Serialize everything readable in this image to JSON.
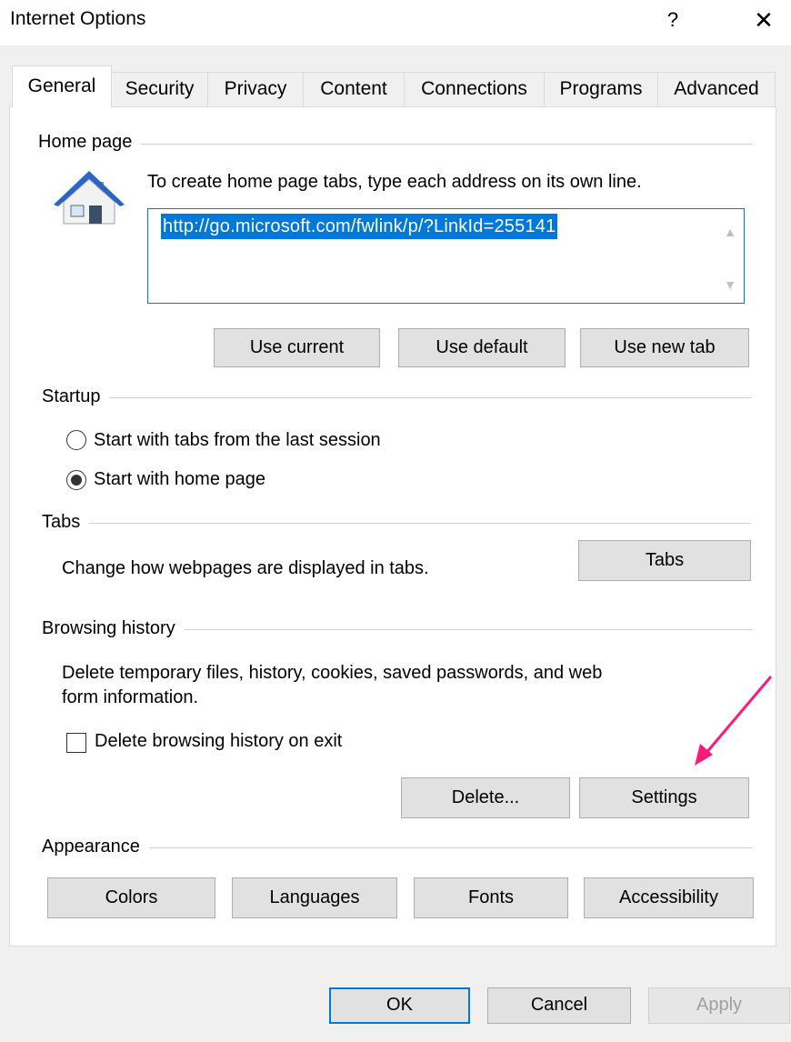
{
  "window": {
    "title": "Internet Options",
    "help_label": "?",
    "close_label": "✕"
  },
  "tabs": [
    {
      "label": "General",
      "active": true
    },
    {
      "label": "Security"
    },
    {
      "label": "Privacy"
    },
    {
      "label": "Content"
    },
    {
      "label": "Connections"
    },
    {
      "label": "Programs"
    },
    {
      "label": "Advanced"
    }
  ],
  "home_page": {
    "group_label": "Home page",
    "instructions": "To create home page tabs, type each address on its own line.",
    "address_value": "http://go.microsoft.com/fwlink/p/?LinkId=255141",
    "use_current_label": "Use current",
    "use_default_label": "Use default",
    "use_new_tab_label": "Use new tab"
  },
  "startup": {
    "group_label": "Startup",
    "option_last_session": "Start with tabs from the last session",
    "option_home_page": "Start with home page",
    "selected": "home_page"
  },
  "tabs_section": {
    "group_label": "Tabs",
    "description": "Change how webpages are displayed in tabs.",
    "button_label": "Tabs"
  },
  "browsing_history": {
    "group_label": "Browsing history",
    "description_line1": "Delete temporary files, history, cookies, saved passwords, and web",
    "description_line2": "form information.",
    "delete_on_exit_label": "Delete browsing history on exit",
    "delete_on_exit_checked": false,
    "delete_label": "Delete...",
    "settings_label": "Settings"
  },
  "appearance": {
    "group_label": "Appearance",
    "colors_label": "Colors",
    "languages_label": "Languages",
    "fonts_label": "Fonts",
    "accessibility_label": "Accessibility"
  },
  "dialog_buttons": {
    "ok_label": "OK",
    "cancel_label": "Cancel",
    "apply_label": "Apply"
  },
  "annotation": {
    "arrow_color": "#ff1a7a"
  },
  "colors": {
    "accent": "#0078d7",
    "button_face": "#e1e1e1",
    "dialog_bg": "#f0f0f0"
  }
}
